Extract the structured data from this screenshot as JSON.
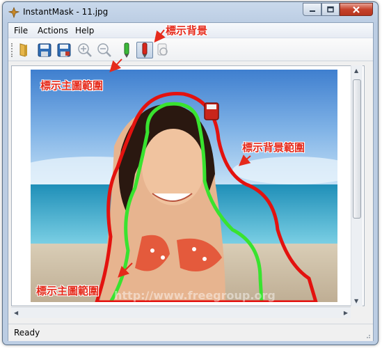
{
  "window": {
    "title": "InstantMask - 11.jpg"
  },
  "menu": {
    "items": [
      "File",
      "Actions",
      "Help"
    ]
  },
  "toolbar": {
    "tools": [
      "open-folder-icon",
      "save-icon",
      "save-as-icon",
      "zoom-in-icon",
      "zoom-out-icon",
      "foreground-marker-icon",
      "background-marker-icon",
      "eraser-icon"
    ],
    "selected_tool": "background-marker-icon"
  },
  "status": {
    "text": "Ready"
  },
  "annotations": {
    "background_marker": "標示背景",
    "foreground_area_top": "標示主圖範圍",
    "background_area": "標示背景範圍",
    "foreground_area_bottom": "標示主圖範圍"
  },
  "photo": {
    "watermark": "http://www.freegroup.org"
  },
  "colors": {
    "accent": "#e52a1b",
    "foreground_mask": "#39e32f",
    "background_mask": "#e3120f"
  }
}
